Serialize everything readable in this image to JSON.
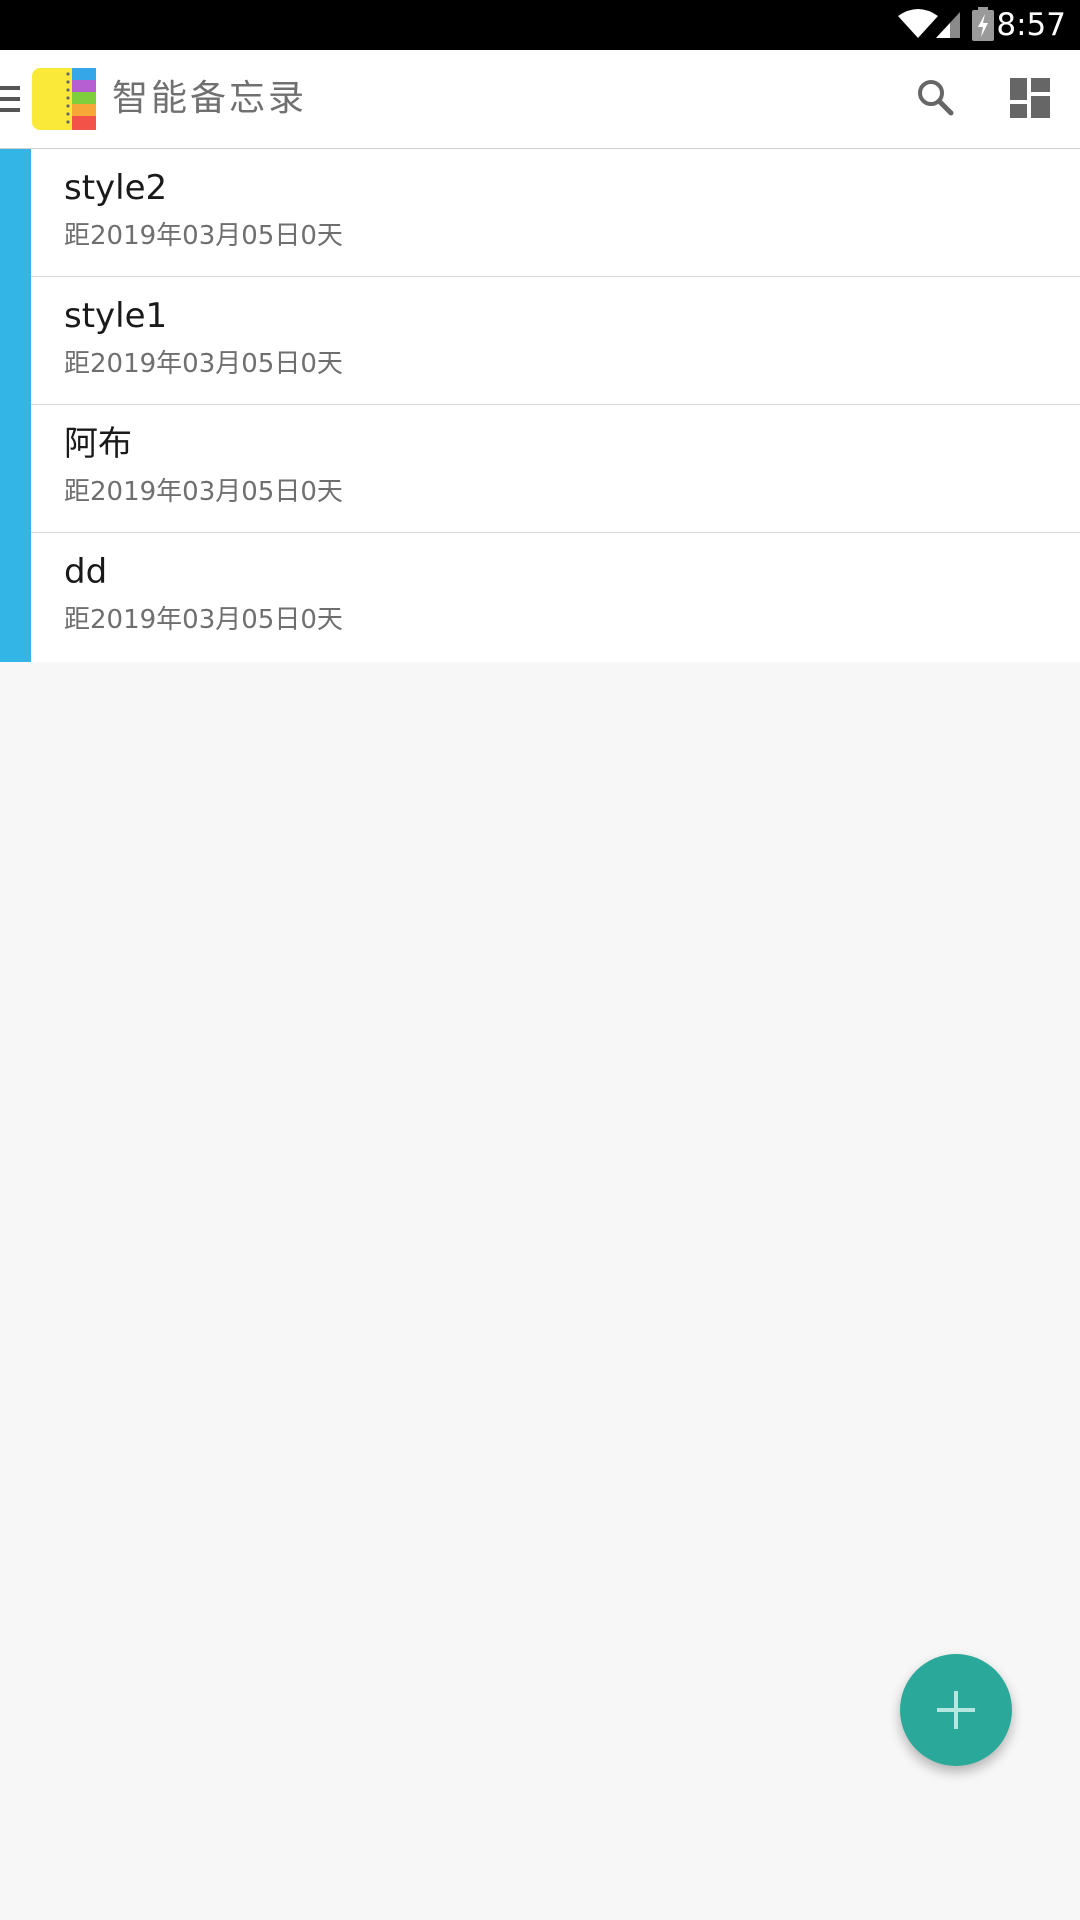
{
  "status_bar": {
    "time": "8:57",
    "icons": [
      "wifi-icon",
      "signal-icon",
      "battery-charging-icon"
    ]
  },
  "app_bar": {
    "title": "智能备忘录",
    "icons": [
      "menu-icon",
      "app-logo-icon",
      "search-icon",
      "dashboard-layout-icon"
    ]
  },
  "memos": [
    {
      "title": "style2",
      "subtitle": "距2019年03月05日0天"
    },
    {
      "title": "style1",
      "subtitle": "距2019年03月05日0天"
    },
    {
      "title": "阿布",
      "subtitle": "距2019年03月05日0天"
    },
    {
      "title": "dd",
      "subtitle": "距2019年03月05日0天"
    }
  ],
  "fab": {
    "icon": "plus-icon"
  },
  "colors": {
    "accent_strip": "#33b5e5",
    "fab": "#2aa89a",
    "background": "#f7f7f7"
  }
}
